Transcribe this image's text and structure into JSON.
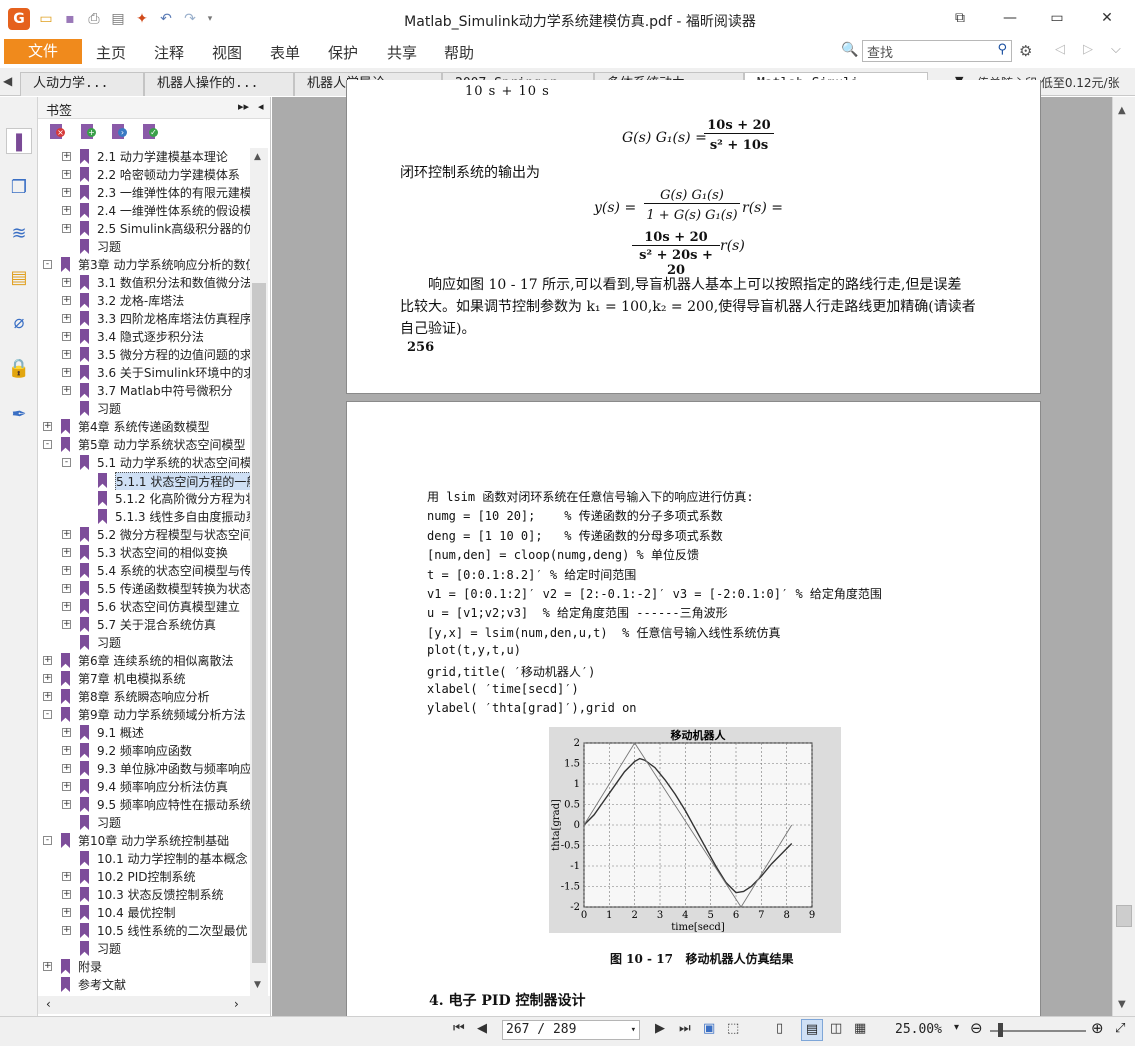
{
  "window": {
    "title": "Matlab_Simulink动力学系统建模仿真.pdf - 福昕阅读器",
    "logo": "G"
  },
  "quick_access_icons": [
    "open-folder-icon",
    "save-icon",
    "print-icon",
    "screen-icon",
    "new-icon",
    "undo-icon",
    "redo-icon",
    "dropdown-icon"
  ],
  "menu": {
    "file": "文件",
    "items": [
      "主页",
      "注释",
      "视图",
      "表单",
      "保护",
      "共享",
      "帮助"
    ]
  },
  "search": {
    "value": "查找"
  },
  "tabs": [
    {
      "label": "人动力学..."
    },
    {
      "label": "机器人操作的..."
    },
    {
      "label": "机器人学导论..."
    },
    {
      "label": "2007-Springer..."
    },
    {
      "label": "多体系统动力..."
    },
    {
      "label": "Matlab_Simuli..."
    }
  ],
  "promo": "传单随心印 低至0.12元/张",
  "bookmarks_panel": {
    "title": "书签",
    "items": [
      {
        "label": "2.1 动力学建模基本理论",
        "level": 2,
        "exp": "+"
      },
      {
        "label": "2.2 哈密顿动力学建模体系",
        "level": 2,
        "exp": "+"
      },
      {
        "label": "2.3 一维弹性体的有限元建模",
        "level": 2,
        "exp": "+"
      },
      {
        "label": "2.4 一维弹性体系统的假设模",
        "level": 2,
        "exp": "+"
      },
      {
        "label": "2.5 Simulink高级积分器的仿",
        "level": 2,
        "exp": "+"
      },
      {
        "label": "习题",
        "level": 2,
        "exp": ""
      },
      {
        "label": "第3章 动力学系统响应分析的数值",
        "level": 1,
        "exp": "-"
      },
      {
        "label": "3.1 数值积分法和数值微分法",
        "level": 2,
        "exp": "+"
      },
      {
        "label": "3.2 龙格-库塔法",
        "level": 2,
        "exp": "+"
      },
      {
        "label": "3.3 四阶龙格库塔法仿真程序",
        "level": 2,
        "exp": "+"
      },
      {
        "label": "3.4 隐式逐步积分法",
        "level": 2,
        "exp": "+"
      },
      {
        "label": "3.5 微分方程的边值问题的求",
        "level": 2,
        "exp": "+"
      },
      {
        "label": "3.6 关于Simulink环境中的求",
        "level": 2,
        "exp": "+"
      },
      {
        "label": "3.7 Matlab中符号微积分",
        "level": 2,
        "exp": "+"
      },
      {
        "label": "习题",
        "level": 2,
        "exp": ""
      },
      {
        "label": "第4章 系统传递函数模型",
        "level": 1,
        "exp": "+"
      },
      {
        "label": "第5章 动力学系统状态空间模型",
        "level": 1,
        "exp": "-"
      },
      {
        "label": "5.1 动力学系统的状态空间模",
        "level": 2,
        "exp": "-"
      },
      {
        "label": "5.1.1 状态空间方程的一般",
        "level": 3,
        "exp": "",
        "selected": true
      },
      {
        "label": "5.1.2 化高阶微分方程为状",
        "level": 3,
        "exp": ""
      },
      {
        "label": "5.1.3 线性多自由度振动系",
        "level": 3,
        "exp": ""
      },
      {
        "label": "5.2 微分方程模型与状态空间",
        "level": 2,
        "exp": "+"
      },
      {
        "label": "5.3 状态空间的相似变换",
        "level": 2,
        "exp": "+"
      },
      {
        "label": "5.4 系统的状态空间模型与传",
        "level": 2,
        "exp": "+"
      },
      {
        "label": "5.5 传递函数模型转换为状态",
        "level": 2,
        "exp": "+"
      },
      {
        "label": "5.6 状态空间仿真模型建立",
        "level": 2,
        "exp": "+"
      },
      {
        "label": "5.7 关于混合系统仿真",
        "level": 2,
        "exp": "+"
      },
      {
        "label": "习题",
        "level": 2,
        "exp": ""
      },
      {
        "label": "第6章 连续系统的相似离散法",
        "level": 1,
        "exp": "+"
      },
      {
        "label": "第7章 机电模拟系统",
        "level": 1,
        "exp": "+"
      },
      {
        "label": "第8章 系统瞬态响应分析",
        "level": 1,
        "exp": "+"
      },
      {
        "label": "第9章 动力学系统频域分析方法",
        "level": 1,
        "exp": "-"
      },
      {
        "label": "9.1 概述",
        "level": 2,
        "exp": "+"
      },
      {
        "label": "9.2 频率响应函数",
        "level": 2,
        "exp": "+"
      },
      {
        "label": "9.3 单位脉冲函数与频率响应",
        "level": 2,
        "exp": "+"
      },
      {
        "label": "9.4 频率响应分析法仿真",
        "level": 2,
        "exp": "+"
      },
      {
        "label": "9.5 频率响应特性在振动系统",
        "level": 2,
        "exp": "+"
      },
      {
        "label": "习题",
        "level": 2,
        "exp": ""
      },
      {
        "label": "第10章 动力学系统控制基础",
        "level": 1,
        "exp": "-"
      },
      {
        "label": "10.1 动力学控制的基本概念",
        "level": 2,
        "exp": ""
      },
      {
        "label": "10.2 PID控制系统",
        "level": 2,
        "exp": "+"
      },
      {
        "label": "10.3 状态反馈控制系统",
        "level": 2,
        "exp": "+"
      },
      {
        "label": "10.4 最优控制",
        "level": 2,
        "exp": "+"
      },
      {
        "label": "10.5 线性系统的二次型最优",
        "level": 2,
        "exp": "+"
      },
      {
        "label": "习题",
        "level": 2,
        "exp": ""
      },
      {
        "label": "附录",
        "level": 1,
        "exp": "+"
      },
      {
        "label": "参考文献",
        "level": 1,
        "exp": ""
      }
    ]
  },
  "page1": {
    "top_fragment": "10            s + 10            s",
    "eq1_lhs": "G(s) G₁(s)  =",
    "eq1_num": "10s + 20",
    "eq1_den": "s² + 10s",
    "closed_loop_label": "闭环控制系统的输出为",
    "eq2_lhs": "y(s)  =",
    "eq2_num": "G(s) G₁(s)",
    "eq2_den": "1 + G(s) G₁(s)",
    "eq2_rhs": "r(s)  =",
    "eq3_num": "10s + 20",
    "eq3_den": "s² + 20s + 20",
    "eq3_rhs": "r(s)",
    "para_line1": "响应如图 10 - 17 所示,可以看到,导盲机器人基本上可以按照指定的路线行走,但是误差",
    "para_line2": "比较大。如果调节控制参数为 k₁ = 100,k₂ = 200,使得导盲机器人行走路线更加精确(请读者",
    "para_line3": "自己验证)。",
    "page_number": "256"
  },
  "page2": {
    "code_lines": [
      "用 lsim 函数对闭环系统在任意信号输入下的响应进行仿真:",
      "numg = [10 20];    % 传递函数的分子多项式系数",
      "deng = [1 10 0];   % 传递函数的分母多项式系数",
      "[num,den] = cloop(numg,deng) % 单位反馈",
      "t = [0:0.1:8.2]′ % 给定时间范围",
      "v1 = [0:0.1:2]′ v2 = [2:-0.1:-2]′ v3 = [-2:0.1:0]′ % 给定角度范围",
      "u = [v1;v2;v3]  % 给定角度范围 ------三角波形",
      "[y,x] = lsim(num,den,u,t)  % 任意信号输入线性系统仿真",
      "plot(t,y,t,u)",
      "grid,title( ′移动机器人′)",
      "xlabel( ′time[secd]′)",
      "ylabel( ′thta[grad]′),grid on"
    ],
    "figure_caption": "图 10 - 17   移动机器人仿真结果",
    "section_heading": "4. 电子 PID 控制器设计"
  },
  "chart_data": {
    "type": "line",
    "title": "移动机器人",
    "xlabel": "time[secd]",
    "ylabel": "thta[grad]",
    "xlim": [
      0,
      9
    ],
    "ylim": [
      -2,
      2
    ],
    "xticks": [
      "0",
      "1",
      "2",
      "3",
      "4",
      "5",
      "6",
      "7",
      "8",
      "9"
    ],
    "yticks": [
      "2",
      "1.5",
      "1",
      "0.5",
      "0",
      "-0.5",
      "-1",
      "-1.5",
      "-2"
    ],
    "grid": true,
    "series": [
      {
        "x": [
          0,
          0.4,
          0.8,
          1.2,
          1.6,
          2.0,
          2.2,
          2.4,
          2.8,
          3.2,
          3.6,
          4.0,
          4.4,
          4.8,
          5.2,
          5.6,
          6.0,
          6.3,
          6.6,
          7.0,
          7.4,
          7.8,
          8.2
        ],
        "values": [
          0,
          0.25,
          0.6,
          0.95,
          1.3,
          1.55,
          1.62,
          1.58,
          1.4,
          1.1,
          0.75,
          0.35,
          -0.1,
          -0.55,
          -1.0,
          -1.4,
          -1.65,
          -1.62,
          -1.5,
          -1.25,
          -0.95,
          -0.7,
          -0.45
        ]
      },
      {
        "x": [
          0,
          2,
          6.2,
          8.2
        ],
        "values": [
          0,
          2,
          -2,
          0
        ]
      }
    ]
  },
  "status": {
    "page_value": "267 / 289",
    "zoom": "25.00%"
  }
}
